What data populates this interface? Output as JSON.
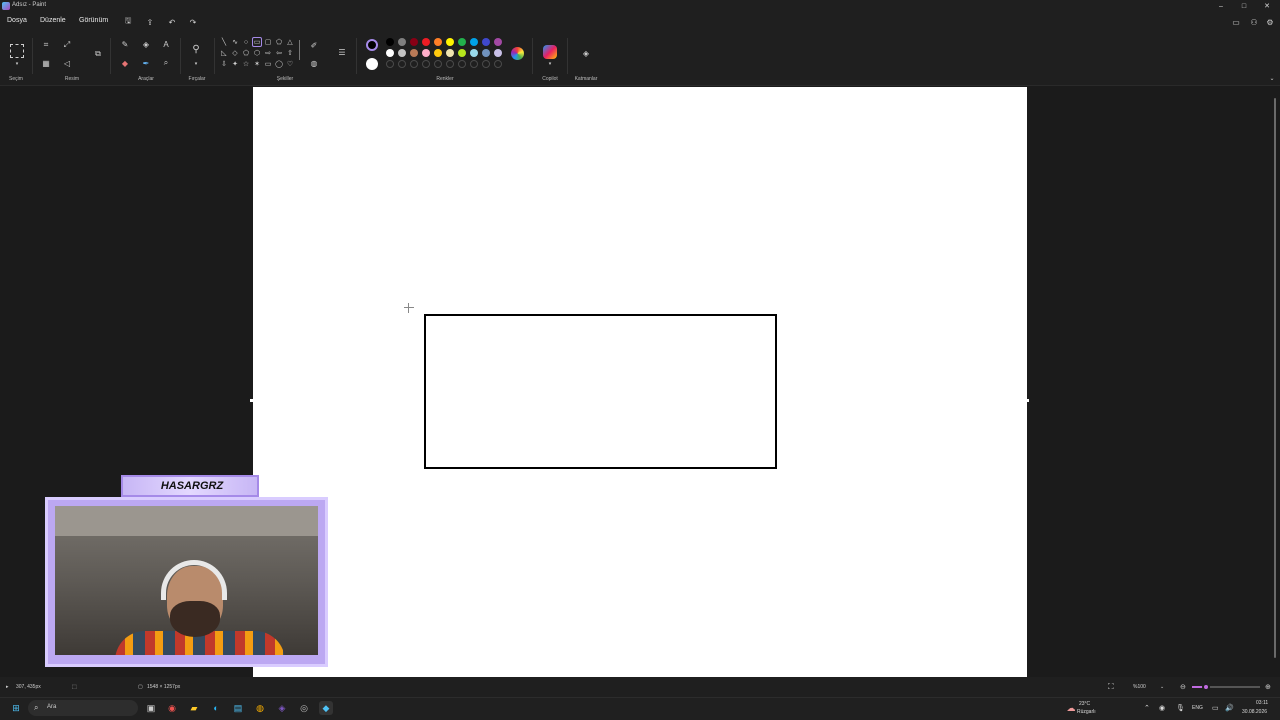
{
  "window": {
    "title": "Adsız - Paint",
    "minimize": "–",
    "maximize": "□",
    "close": "✕"
  },
  "menu": {
    "file": "Dosya",
    "edit": "Düzenle",
    "view": "Görünüm"
  },
  "ribbon": {
    "groups": {
      "selection": "Seçim",
      "image": "Resim",
      "tools": "Araçlar",
      "brushes": "Fırçalar",
      "shapes": "Şekiller",
      "colors": "Renkler",
      "copilot": "Copilot",
      "layers": "Katmanlar"
    },
    "current_color_1": "#000000",
    "current_color_2": "#ffffff",
    "palette_row1": [
      "#000000",
      "#7f7f7f",
      "#880015",
      "#ed1c24",
      "#ff7f27",
      "#fff200",
      "#22b14c",
      "#00a2e8",
      "#3f48cc",
      "#a349a4"
    ],
    "palette_row2": [
      "#ffffff",
      "#c3c3c3",
      "#b97a57",
      "#ffaec9",
      "#ffc90e",
      "#efe4b0",
      "#b5e61d",
      "#99d9ea",
      "#7092be",
      "#c8bfe7"
    ]
  },
  "status": {
    "cursor_pos": "307, 435px",
    "canvas_size": "1548 × 1257px",
    "zoom": "%100",
    "zoom_level": 0.2
  },
  "webcam": {
    "name": "HASARGRZ"
  },
  "taskbar": {
    "search_placeholder": "Ara",
    "weather_temp": "23°C",
    "weather_desc": "Rüzgarlı",
    "language": "ENG",
    "time": "03:11",
    "date": "30.08.2026"
  }
}
